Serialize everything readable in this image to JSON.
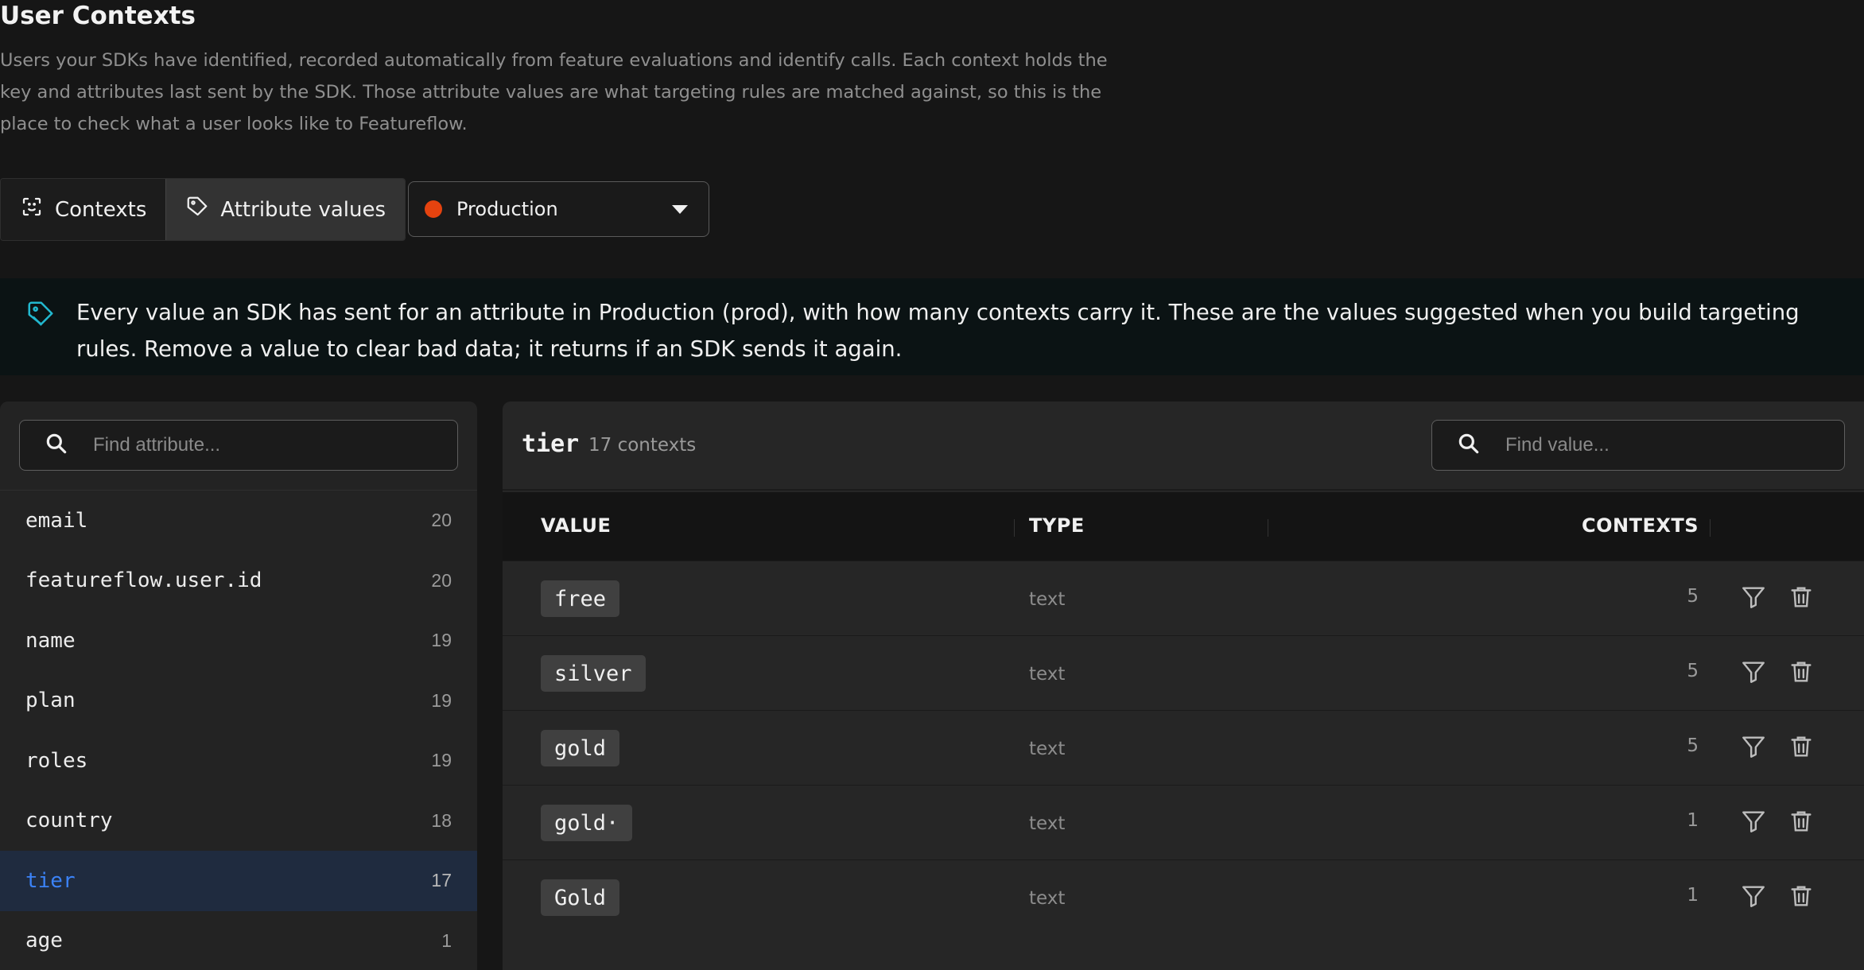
{
  "header": {
    "title": "User Contexts",
    "description": "Users your SDKs have identified, recorded automatically from feature evaluations and identify calls. Each context holds the key and attributes last sent by the SDK. Those attribute values are what targeting rules are matched against, so this is the place to check what a user looks like to Featureflow."
  },
  "view_toggle": {
    "contexts_label": "Contexts",
    "attribute_values_label": "Attribute values",
    "active": "Attribute values"
  },
  "environment": {
    "label": "Production",
    "dot_color": "#e5430f"
  },
  "info_banner": {
    "icon": "tag-icon",
    "text": "Every value an SDK has sent for an attribute in Production (prod), with how many contexts carry it. These are the values suggested when you build targeting rules. Remove a value to clear bad data; it returns if an SDK sends it again."
  },
  "attribute_search": {
    "placeholder": "Find attribute..."
  },
  "attributes": [
    {
      "name": "email",
      "count": "20"
    },
    {
      "name": "featureflow.user.id",
      "count": "20"
    },
    {
      "name": "name",
      "count": "19"
    },
    {
      "name": "plan",
      "count": "19"
    },
    {
      "name": "roles",
      "count": "19"
    },
    {
      "name": "country",
      "count": "18"
    },
    {
      "name": "tier",
      "count": "17",
      "selected": true
    },
    {
      "name": "age",
      "count": "1"
    }
  ],
  "detail": {
    "title": "tier",
    "subtitle": "17 contexts",
    "value_search": {
      "placeholder": "Find value..."
    },
    "columns": {
      "value": "VALUE",
      "type": "TYPE",
      "contexts": "CONTEXTS"
    },
    "rows": [
      {
        "value": "free",
        "type": "text",
        "contexts": "5"
      },
      {
        "value": "silver",
        "type": "text",
        "contexts": "5"
      },
      {
        "value": "gold",
        "type": "text",
        "contexts": "5"
      },
      {
        "value": "gold·",
        "type": "text",
        "contexts": "1"
      },
      {
        "value": "Gold",
        "type": "text",
        "contexts": "1"
      }
    ]
  },
  "colors": {
    "accent_blue": "#3b82f6",
    "info_icon": "#22b8cf"
  }
}
